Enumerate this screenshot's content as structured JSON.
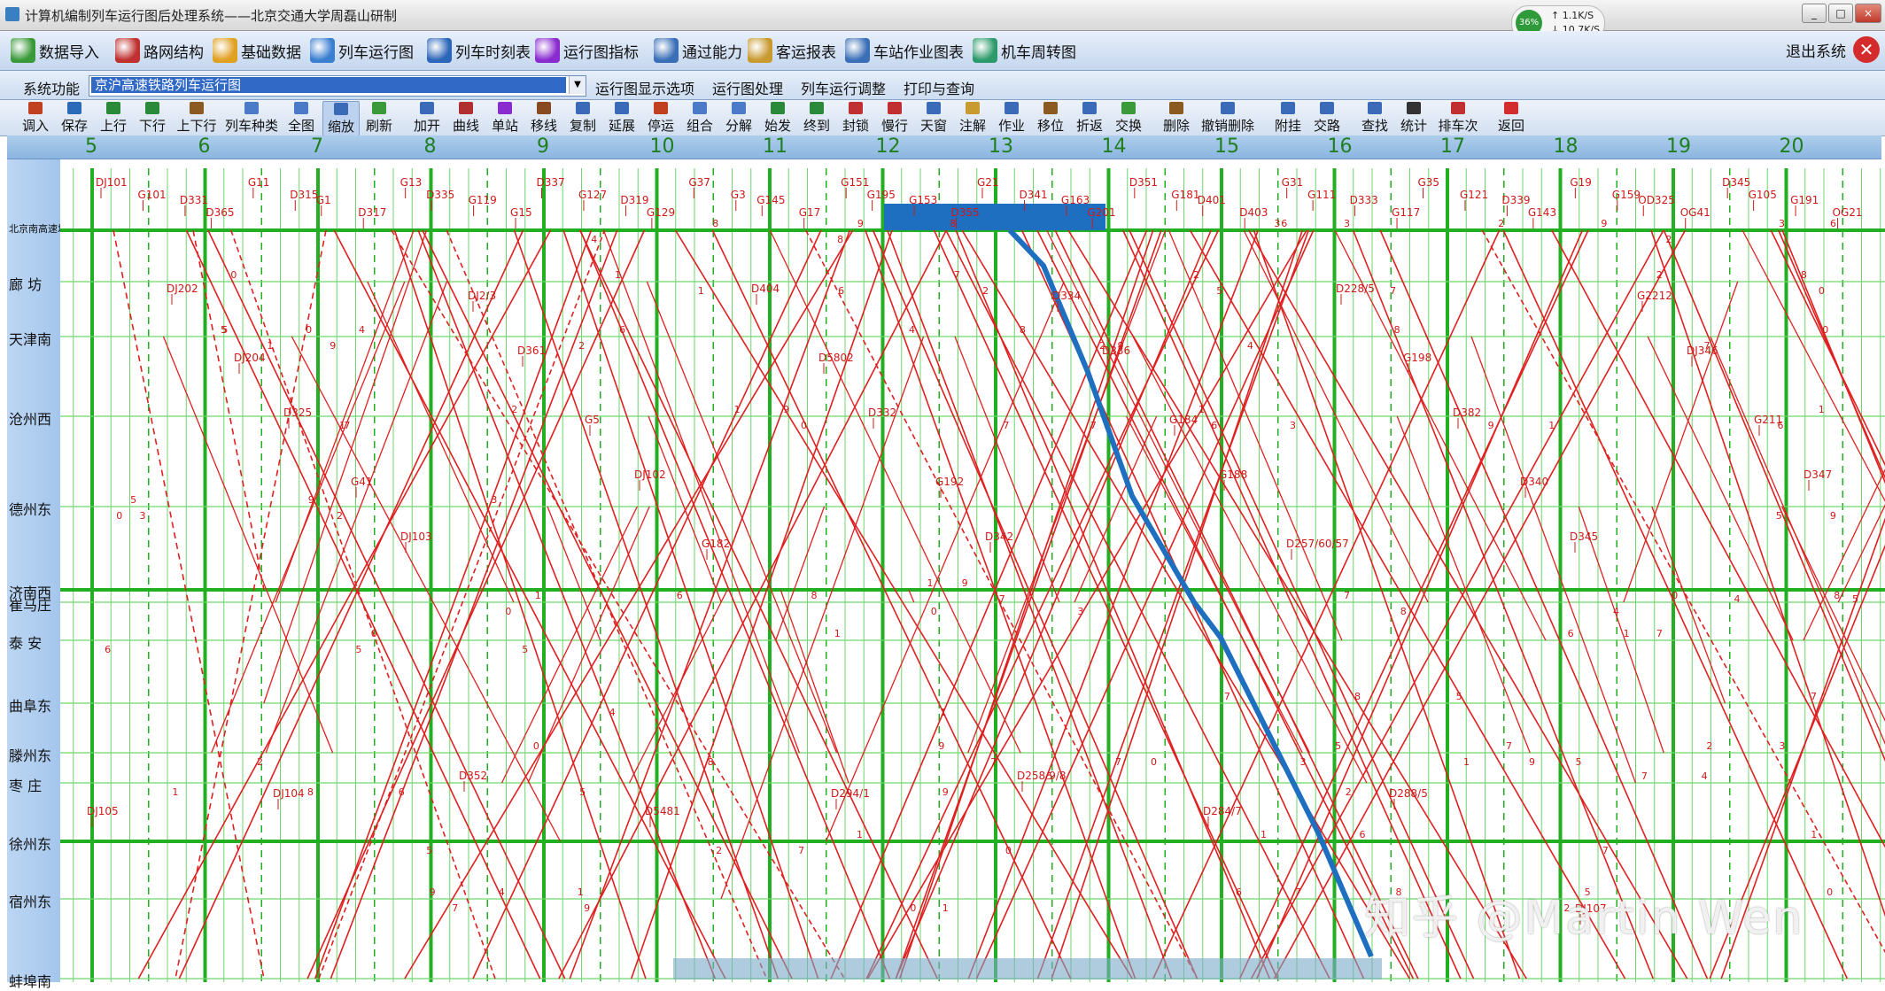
{
  "window": {
    "title": "计算机编制列车运行图后处理系统——北京交通大学周磊山研制",
    "controls": [
      "_",
      "□",
      "×"
    ]
  },
  "netmon": {
    "percent": "36%",
    "up": "↑ 1.1K/S",
    "down": "↓ 10.7K/S"
  },
  "menubar": {
    "items": [
      {
        "label": "数据导入",
        "icon": "data-import-icon",
        "color": "#3a9a3a"
      },
      {
        "label": "路网结构",
        "icon": "network-icon",
        "color": "#c03030"
      },
      {
        "label": "基础数据",
        "icon": "base-data-icon",
        "color": "#e0a020"
      },
      {
        "label": "列车运行图",
        "icon": "train-diagram-icon",
        "color": "#3b7fd1"
      },
      {
        "label": "列车时刻表",
        "icon": "timetable-icon",
        "color": "#2c66b8"
      },
      {
        "label": "运行图指标",
        "icon": "indicator-icon",
        "color": "#8a2bd0"
      },
      {
        "label": "通过能力",
        "icon": "capacity-icon",
        "color": "#3a6fb8"
      },
      {
        "label": "客运报表",
        "icon": "report-icon",
        "color": "#c89a30"
      },
      {
        "label": "车站作业图表",
        "icon": "station-ops-icon",
        "color": "#3a6fb8"
      },
      {
        "label": "机车周转图",
        "icon": "locomotive-icon",
        "color": "#2c9a6a"
      }
    ],
    "exit_label": "退出系统"
  },
  "funcbar": {
    "label": "系统功能",
    "selected_diagram": "京沪高速铁路列车运行图",
    "menus": [
      "运行图显示选项",
      "运行图处理",
      "列车运行调整",
      "打印与查询"
    ]
  },
  "toolbar": {
    "buttons": [
      "调入",
      "保存",
      "上行",
      "下行",
      "上下行",
      "列车种类",
      "全图",
      "缩放",
      "刷新",
      "加开",
      "曲线",
      "单站",
      "移线",
      "复制",
      "延展",
      "停运",
      "组合",
      "分解",
      "始发",
      "终到",
      "封锁",
      "慢行",
      "天窗",
      "注解",
      "作业",
      "移位",
      "折返",
      "交换",
      "删除",
      "撤销删除",
      "附挂",
      "交路",
      "查找",
      "统计",
      "排车次",
      "返回"
    ],
    "active": "缩放"
  },
  "hours": [
    "5",
    "6",
    "7",
    "8",
    "9",
    "10",
    "11",
    "12",
    "13",
    "14",
    "15",
    "16",
    "17",
    "18",
    "19",
    "20"
  ],
  "stations": [
    {
      "name": "北京南高速场",
      "small": true
    },
    {
      "name": "廊  坊"
    },
    {
      "name": "天津南"
    },
    {
      "name": "沧州西"
    },
    {
      "name": "德州东"
    },
    {
      "name": "济南西"
    },
    {
      "name": "崔马庄"
    },
    {
      "name": "泰  安"
    },
    {
      "name": "曲阜东"
    },
    {
      "name": "滕州东"
    },
    {
      "name": "枣  庄"
    },
    {
      "name": "徐州东"
    },
    {
      "name": "宿州东"
    },
    {
      "name": "蚌埠南"
    }
  ],
  "train_labels_top": [
    "DJ101",
    "G101",
    "D331",
    "D365",
    "G11",
    "D315",
    "G1",
    "D317",
    "G13",
    "D335",
    "G119",
    "G15",
    "D337",
    "G127",
    "D319",
    "G129",
    "G37",
    "G3",
    "G145",
    "G17",
    "G151",
    "G195",
    "G153",
    "D355",
    "G21",
    "D341",
    "G163",
    "G201",
    "D351",
    "G181",
    "D401",
    "D403",
    "G31",
    "G111",
    "D333",
    "G117",
    "G35",
    "G121",
    "D339",
    "G143",
    "G19",
    "G159",
    "OD325",
    "OG41",
    "D345",
    "G105",
    "G191",
    "OG21"
  ],
  "train_labels_mid": [
    "DJ202",
    "DJ204",
    "D325",
    "G41",
    "DJ103",
    "DJ2/3",
    "D361",
    "G5",
    "DJ102",
    "G182",
    "D404",
    "D5802",
    "D332",
    "G192",
    "D342",
    "D334",
    "D336",
    "G184",
    "G188",
    "D257/60/57",
    "D228/5",
    "G198",
    "D382",
    "D340",
    "D345",
    "G2212",
    "DJ346",
    "G211",
    "D347"
  ],
  "train_labels_low": [
    "DJ105",
    "DJ104",
    "D352",
    "D5481",
    "D294/1",
    "D258/9/8",
    "D284/7",
    "D288/5",
    "DJ107"
  ],
  "watermark": "知乎 @Martin Wen"
}
